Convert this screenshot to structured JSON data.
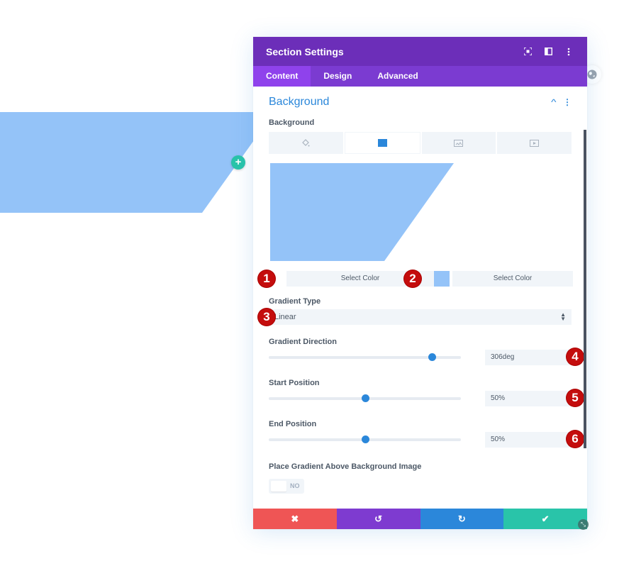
{
  "page": {
    "shape_color": "#94c3f8",
    "add_button_label": "+"
  },
  "modal": {
    "title": "Section Settings",
    "header_icons": [
      "focus-icon",
      "split-view-icon",
      "kebab-icon"
    ],
    "tabs": [
      {
        "label": "Content",
        "active": true
      },
      {
        "label": "Design",
        "active": false
      },
      {
        "label": "Advanced",
        "active": false
      }
    ],
    "section": {
      "title": "Background",
      "expanded": true
    },
    "background": {
      "label": "Background",
      "type_tabs": [
        {
          "icon": "paint-bucket-icon",
          "active": false
        },
        {
          "icon": "gradient-icon",
          "active": true
        },
        {
          "icon": "image-icon",
          "active": false
        },
        {
          "icon": "video-icon",
          "active": false
        }
      ],
      "preview_color": "#94c3f8",
      "color1_label": "Select Color",
      "color2_label": "Select Color",
      "color2_swatch": "#94c3f8"
    },
    "gradient_type": {
      "label": "Gradient Type",
      "value": "Linear"
    },
    "gradient_direction": {
      "label": "Gradient Direction",
      "value": "306deg",
      "slider_fraction": 0.85
    },
    "start_position": {
      "label": "Start Position",
      "value": "50%",
      "slider_fraction": 0.5
    },
    "end_position": {
      "label": "End Position",
      "value": "50%",
      "slider_fraction": 0.5
    },
    "place_gradient": {
      "label": "Place Gradient Above Background Image",
      "toggle_text": "NO",
      "on": false
    },
    "footer": {
      "cancel_icon": "✖",
      "undo_icon": "↺",
      "redo_icon": "↻",
      "save_icon": "✔"
    }
  },
  "annotations": [
    "1",
    "2",
    "3",
    "4",
    "5",
    "6"
  ]
}
